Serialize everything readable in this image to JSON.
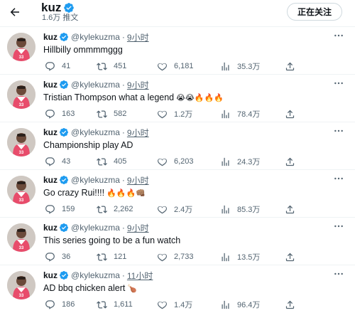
{
  "header": {
    "title": "kuz",
    "meta": "1.6万 推文",
    "follow_button": "正在关注"
  },
  "tweets": [
    {
      "name": "kuz",
      "handle": "@kylekuzma",
      "dot": "·",
      "time": "9小时",
      "text": "Hillbilly ommmmggg",
      "emojis": "",
      "replies": "41",
      "retweets": "451",
      "likes": "6,181",
      "views": "35.3万"
    },
    {
      "name": "kuz",
      "handle": "@kylekuzma",
      "dot": "·",
      "time": "9小时",
      "text": "Tristian Thompson what a legend",
      "emojis": "😭😭🔥🔥🔥",
      "replies": "163",
      "retweets": "582",
      "likes": "1.2万",
      "views": "78.4万"
    },
    {
      "name": "kuz",
      "handle": "@kylekuzma",
      "dot": "·",
      "time": "9小时",
      "text": "Championship play AD",
      "emojis": "",
      "replies": "43",
      "retweets": "405",
      "likes": "6,203",
      "views": "24.3万"
    },
    {
      "name": "kuz",
      "handle": "@kylekuzma",
      "dot": "·",
      "time": "9小时",
      "text": "Go crazy Rui!!!!",
      "emojis": "🔥🔥🔥👊🏽",
      "replies": "159",
      "retweets": "2,262",
      "likes": "2.4万",
      "views": "85.3万"
    },
    {
      "name": "kuz",
      "handle": "@kylekuzma",
      "dot": "·",
      "time": "9小时",
      "text": "This series going to be a fun watch",
      "emojis": "",
      "replies": "36",
      "retweets": "121",
      "likes": "2,733",
      "views": "13.5万"
    },
    {
      "name": "kuz",
      "handle": "@kylekuzma",
      "dot": "·",
      "time": "11小时",
      "text": "AD bbq chicken alert",
      "emojis": "🍗",
      "replies": "186",
      "retweets": "1,611",
      "likes": "1.4万",
      "views": "96.4万"
    }
  ],
  "icons": {
    "back": "arrow-left-icon",
    "verified": "verified-badge-icon",
    "more": "more-horizontal-icon",
    "reply": "reply-icon",
    "retweet": "retweet-icon",
    "like": "heart-icon",
    "views": "views-chart-icon",
    "share": "share-icon"
  },
  "colors": {
    "verified": "#1d9bf0",
    "muted": "#536471",
    "text": "#0f1419",
    "border": "#eff3f4",
    "jersey": "#e84c6b"
  }
}
